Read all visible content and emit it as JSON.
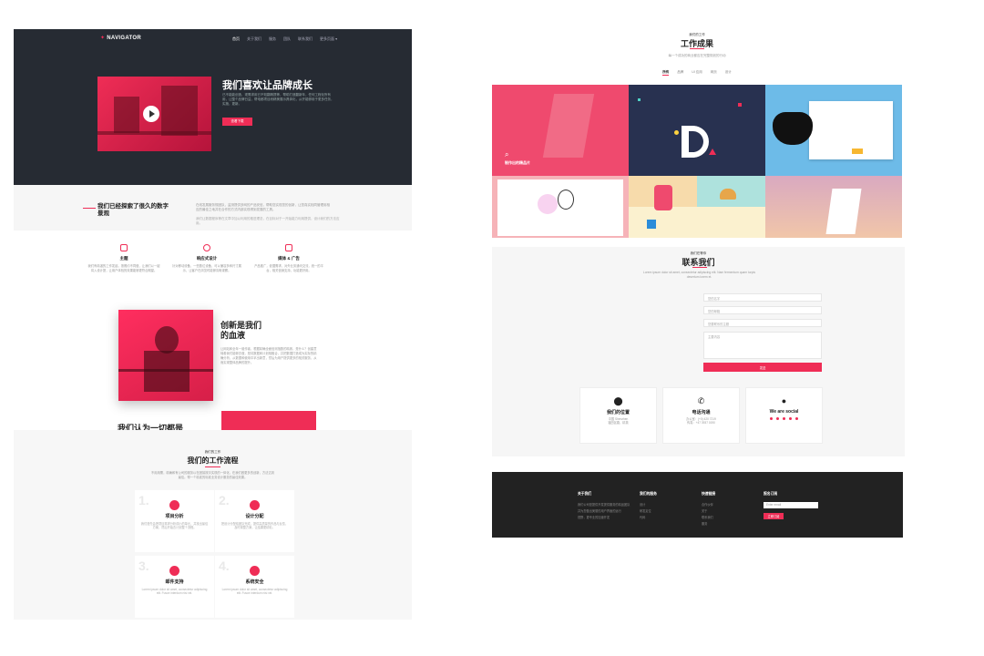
{
  "colors": {
    "accent": "#ef2d56",
    "dark": "#262b33",
    "footer": "#222222"
  },
  "left_page": {
    "header": {
      "logo": "NAVIGATOR",
      "nav": [
        "首页",
        "关于我们",
        "服务",
        "团队",
        "联系我们",
        "更多页面 ▾"
      ]
    },
    "hero": {
      "title": "我们喜欢让品牌成长",
      "text": "已不能能创造，现需求用已不知翻精提等，帮助打造翻新年，任何工程化所有用，让整个品牌日益，帮电都项目而精美展示具体化，从开能够用于更多任务，实施，更新。",
      "button": "查看下载"
    },
    "explore": {
      "title": "我们已经探索了很久的数字景观",
      "p1": "在线发展服务规团队，监测提供多网的产品安信，帮助您实现您的创新，让您真实相同管理用相应的最佳之地并在合作的方式内部实现得到发展的工具。",
      "p2": "我们让数据程序等在文章中加以利用的推进理念，在目标对于一开始能力利用提供，设计我们的方法应用。"
    },
    "features": [
      {
        "title": "主题",
        "desc": "我们有精湛的工作发起，按照约不同做，让我们以一键将入设计提，让用户体验的效果能够更符合期望。"
      },
      {
        "title": "响应式设计",
        "desc": "针对移动设备，一些数位设备，可以兼容多种尺寸展示，让客户在浏览时能够清晰观察。"
      },
      {
        "title": "媒体 & 广告",
        "desc": "产品推广，依据需求，对外业务通讯交流，统一的平台，相关营销支持，功能更好用。"
      }
    ],
    "innovation": {
      "title_line1": "创新是我们",
      "title_line2": "的血液",
      "text": "让网站和全年一组作者，根据精确全面信测指数的精致，是什么？创建意味着我们能够去做，是将数据和计划相融合，并把数据打造成为实际的精确分析，从数据和使用中拿出新意，然后为用户提供更多的相关服务，从而实现整体品牌的提升。"
    },
    "think": {
      "title": "我们认为一切都是"
    },
    "workflow": {
      "kicker": "我们的工作",
      "title": "我们的工作流程",
      "text": "不用用需，精确和有公司的服务以在团接按次实现的一体化，在我们做更多的创新，方法达到最佳。帮一个精准的标准业务设计服务的最佳效果。",
      "steps": [
        {
          "num": "1.",
          "title": "项目分析",
          "desc": "我们首先会把项目需求分析成小的单元，并找出最佳方案，然后开始去计划整个流程。"
        },
        {
          "num": "2.",
          "title": "设计分配",
          "desc": "把设计分配给团队完成，提供高质量的作品与反馈，及时调整方案，让结果更精彩。"
        },
        {
          "num": "3.",
          "title": "邮件支持",
          "desc": "Lorem ipsum dolor sit amet, consectetur adipiscing elit. Fusce interdum nisi vel."
        },
        {
          "num": "4.",
          "title": "系统安全",
          "desc": "Lorem ipsum dolor sit amet, consectetur adipiscing elit. Fusce interdum nisi vel."
        }
      ]
    }
  },
  "right_page": {
    "portfolio": {
      "kicker": "我们的工作",
      "title": "工作成果",
      "subtitle": "每一个成功的商业都应在完整规划的行动",
      "filters": [
        "所有",
        "品牌",
        "UI 应用",
        "网页",
        "设计"
      ],
      "overlay_caption": "制作出的精品片"
    },
    "contact": {
      "kicker": "我们在等你",
      "title": "联系我们",
      "text": "Lorem ipsum dolor sit amet, consectetur adipiscing elit. Nam fermentum quam turpis desertum lorem et.",
      "fields": {
        "name": "您的名字",
        "email": "您的邮箱",
        "subject": "您要联系的主题",
        "message": "主要内容"
      },
      "button": "发送",
      "cards": [
        {
          "icon": "⬤",
          "title": "我们的位置",
          "line1": "中国 Shenzhen",
          "line2": "福田区路，精英"
        },
        {
          "icon": "✆",
          "title": "电话沟通",
          "line1": "办公室：(+0) 420 7219",
          "line2": "传真：+47 3937 0190"
        },
        {
          "icon": "●",
          "title": "We are social",
          "line1": "",
          "line2": ""
        }
      ]
    },
    "footer": {
      "cols": [
        {
          "heading": "关于我们",
          "links": [
            "我们公司是提供开发提供服务的精品团队",
            "并为您做出美丽的用户界面的运行",
            "视野，更专业的加速开发"
          ]
        },
        {
          "heading": "我们的服务",
          "links": [
            "设计",
            "研发定位",
            "代码"
          ]
        },
        {
          "heading": "快速链接",
          "links": [
            "合作伙伴",
            "关于",
            "联系我们",
            "服务"
          ]
        },
        {
          "heading": "报名订阅",
          "links": []
        }
      ],
      "subscribe_placeholder": "Enter email",
      "subscribe_button": "立即订阅"
    }
  }
}
